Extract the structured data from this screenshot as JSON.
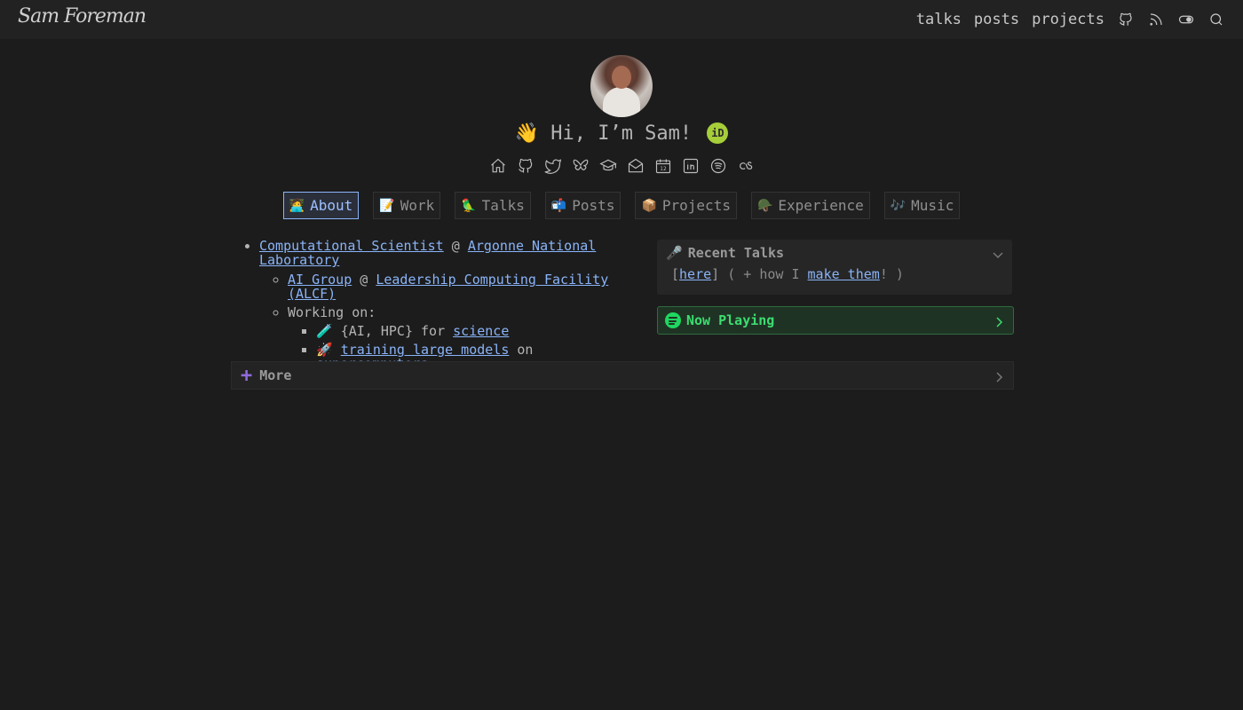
{
  "site": {
    "logo": "Sam Foreman"
  },
  "nav": {
    "links": [
      "talks",
      "posts",
      "projects"
    ]
  },
  "hero": {
    "wave": "👋",
    "greeting": "Hi, I’m Sam!",
    "orcid": "iD"
  },
  "tabs": [
    {
      "emoji": "🧑‍💻",
      "label": "About"
    },
    {
      "emoji": "📝",
      "label": "Work"
    },
    {
      "emoji": "🦜",
      "label": "Talks"
    },
    {
      "emoji": "📬",
      "label": "Posts"
    },
    {
      "emoji": "📦",
      "label": "Projects"
    },
    {
      "emoji": "🪖",
      "label": "Experience"
    },
    {
      "emoji": "🎶",
      "label": "Music"
    }
  ],
  "about": {
    "role": "Computational Scientist",
    "at": "@",
    "org": "Argonne National Laboratory",
    "group": "AI Group",
    "facility": "Leadership Computing Facility (ALCF)",
    "working_on": "Working on:",
    "item1": {
      "emoji": "🧪",
      "text": "{AI, HPC} for",
      "link": "science"
    },
    "item2": {
      "emoji": "🚀",
      "link1": "training large models",
      "mid": "on",
      "link2": "supercomputers"
    }
  },
  "recent_talks": {
    "title": "Recent Talks",
    "emoji": "🎤",
    "open_bracket": "[",
    "here": "here",
    "close_bracket": "]",
    "paren_open": "( + how I",
    "make": "make them",
    "paren_close": "! )"
  },
  "now_playing": {
    "title": "Now Playing"
  },
  "more": {
    "title": "More"
  }
}
